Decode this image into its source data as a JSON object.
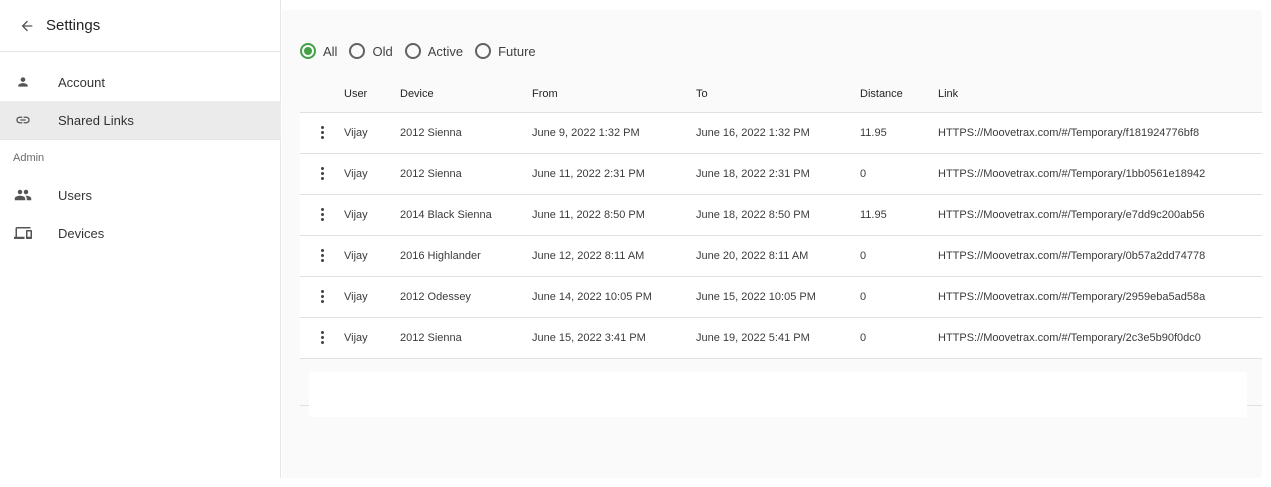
{
  "sidebar": {
    "title": "Settings",
    "items_top": [
      {
        "label": "Account",
        "icon": "person-icon"
      },
      {
        "label": "Shared Links",
        "icon": "link-icon",
        "selected": true
      }
    ],
    "section_label": "Admin",
    "items_admin": [
      {
        "label": "Users",
        "icon": "people-icon"
      },
      {
        "label": "Devices",
        "icon": "devices-icon"
      }
    ]
  },
  "filters": {
    "options": [
      {
        "label": "All",
        "checked": true
      },
      {
        "label": "Old",
        "checked": false
      },
      {
        "label": "Active",
        "checked": false
      },
      {
        "label": "Future",
        "checked": false
      }
    ]
  },
  "table": {
    "headers": {
      "user": "User",
      "device": "Device",
      "from": "From",
      "to": "To",
      "distance": "Distance",
      "link": "Link"
    },
    "rows": [
      {
        "user": "Vijay",
        "device": "2012 Sienna",
        "from": "June 9, 2022 1:32 PM",
        "to": "June 16, 2022 1:32 PM",
        "distance": "11.95",
        "link": "HTTPS://Moovetrax.com/#/Temporary/f181924776bf8"
      },
      {
        "user": "Vijay",
        "device": "2012 Sienna",
        "from": "June 11, 2022 2:31 PM",
        "to": "June 18, 2022 2:31 PM",
        "distance": "0",
        "link": "HTTPS://Moovetrax.com/#/Temporary/1bb0561e18942"
      },
      {
        "user": "Vijay",
        "device": "2014 Black Sienna",
        "from": "June 11, 2022 8:50 PM",
        "to": "June 18, 2022 8:50 PM",
        "distance": "11.95",
        "link": "HTTPS://Moovetrax.com/#/Temporary/e7dd9c200ab56"
      },
      {
        "user": "Vijay",
        "device": "2016 Highlander",
        "from": "June 12, 2022 8:11 AM",
        "to": "June 20, 2022 8:11 AM",
        "distance": "0",
        "link": "HTTPS://Moovetrax.com/#/Temporary/0b57a2dd74778"
      },
      {
        "user": "Vijay",
        "device": "2012 Odessey",
        "from": "June 14, 2022 10:05 PM",
        "to": "June 15, 2022 10:05 PM",
        "distance": "0",
        "link": "HTTPS://Moovetrax.com/#/Temporary/2959eba5ad58a"
      },
      {
        "user": "Vijay",
        "device": "2012 Sienna",
        "from": "June 15, 2022 3:41 PM",
        "to": "June 19, 2022 5:41 PM",
        "distance": "0",
        "link": "HTTPS://Moovetrax.com/#/Temporary/2c3e5b90f0dc0"
      }
    ]
  },
  "colors": {
    "radio_checked": "#43a047",
    "selected_item_bg": "#ebebeb",
    "main_bg": "#fafafa"
  }
}
